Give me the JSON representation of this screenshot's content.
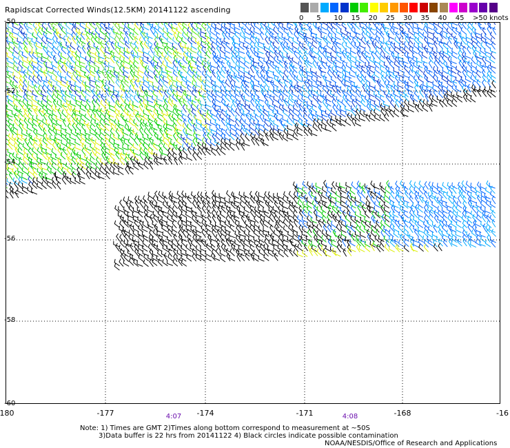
{
  "title": "Rapidscat Corrected Winds(12.5KM) 20141122 ascending",
  "legend": {
    "colors": [
      "#555555",
      "#aaaaaa",
      "#00aaff",
      "#0066ff",
      "#0033cc",
      "#00cc00",
      "#44ee00",
      "#ffff00",
      "#ffcc00",
      "#ff9900",
      "#ff5500",
      "#ff0000",
      "#cc0000",
      "#884400",
      "#aa8855",
      "#ff00ff",
      "#cc00cc",
      "#9900cc",
      "#6600aa",
      "#550088"
    ],
    "labels": [
      "0",
      "5",
      "10",
      "15",
      "20",
      "25",
      "30",
      "35",
      "40",
      "45",
      ">50 knots"
    ]
  },
  "axes": {
    "x_ticks": [
      "-180",
      "-177",
      "-174",
      "-171",
      "-168",
      "-16"
    ],
    "y_ticks": [
      "-50",
      "-52",
      "-54",
      "-56",
      "-58",
      "-60"
    ]
  },
  "time_labels": [
    "4:07",
    "4:08"
  ],
  "notes": {
    "line1": "Note: 1) Times are GMT 2)Times along bottom correspond to measurement at ~50S",
    "line2": "3)Data buffer is 22 hrs from 20141122 4) Black circles indicate possible contamination",
    "line3": "NOAA/NESDIS/Office of Research and Applications"
  }
}
